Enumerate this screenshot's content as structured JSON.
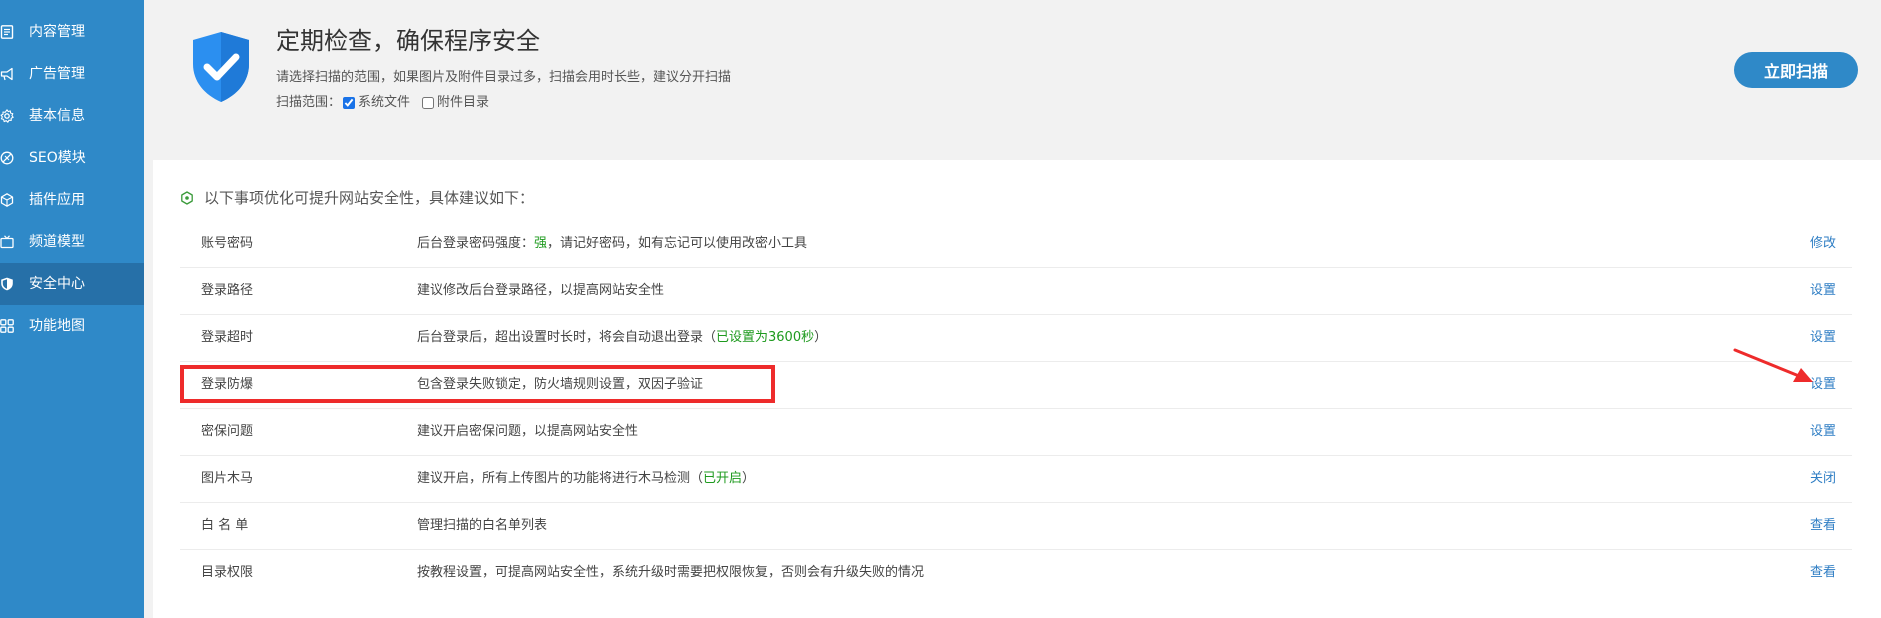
{
  "sidebar": {
    "items": [
      {
        "label": "内容管理",
        "icon": "document-icon",
        "active": false
      },
      {
        "label": "广告管理",
        "icon": "megaphone-icon",
        "active": false
      },
      {
        "label": "基本信息",
        "icon": "gear-icon",
        "active": false
      },
      {
        "label": "SEO模块",
        "icon": "tag-icon",
        "active": false
      },
      {
        "label": "插件应用",
        "icon": "hexagon-icon",
        "active": false
      },
      {
        "label": "频道模型",
        "icon": "tv-icon",
        "active": false
      },
      {
        "label": "安全中心",
        "icon": "shield-icon",
        "active": true
      },
      {
        "label": "功能地图",
        "icon": "grid-icon",
        "active": false
      }
    ]
  },
  "header": {
    "title": "定期检查，确保程序安全",
    "description": "请选择扫描的范围，如果图片及附件目录过多，扫描会用时长些，建议分开扫描",
    "scope_label": "扫描范围：",
    "scope_options": [
      {
        "label": "系统文件",
        "checked": true
      },
      {
        "label": "附件目录",
        "checked": false
      }
    ],
    "scan_button": "立即扫描"
  },
  "main": {
    "intro": "以下事项优化可提升网站安全性，具体建议如下：",
    "rows": [
      {
        "name": "账号密码",
        "desc_before": "后台登录密码强度：",
        "desc_highlight": "强",
        "desc_after": "，请记好密码，如有忘记可以使用改密小工具",
        "action": "修改"
      },
      {
        "name": "登录路径",
        "desc_before": "建议修改后台登录路径，以提高网站安全性",
        "desc_highlight": "",
        "desc_after": "",
        "action": "设置"
      },
      {
        "name": "登录超时",
        "desc_before": "后台登录后，超出设置时长时，将会自动退出登录（",
        "desc_highlight": "已设置为3600秒",
        "desc_after": "）",
        "action": "设置"
      },
      {
        "name": "登录防爆",
        "desc_before": "包含登录失败锁定，防火墙规则设置，双因子验证",
        "desc_highlight": "",
        "desc_after": "",
        "action": "设置"
      },
      {
        "name": "密保问题",
        "desc_before": "建议开启密保问题，以提高网站安全性",
        "desc_highlight": "",
        "desc_after": "",
        "action": "设置"
      },
      {
        "name": "图片木马",
        "desc_before": "建议开启，所有上传图片的功能将进行木马检测（",
        "desc_highlight": "已开启",
        "desc_after": "）",
        "action": "关闭"
      },
      {
        "name": "白 名 单",
        "desc_before": "管理扫描的白名单列表",
        "desc_highlight": "",
        "desc_after": "",
        "action": "查看"
      },
      {
        "name": "目录权限",
        "desc_before": "按教程设置，可提高网站安全性，系统升级时需要把权限恢复，否则会有升级失败的情况",
        "desc_highlight": "",
        "desc_after": "",
        "action": "查看"
      }
    ]
  },
  "colors": {
    "sidebar": "#2f89c8",
    "sidebar_active": "#2670a8",
    "accent": "#2f89c8",
    "link": "#2f7ec4",
    "ok_green": "#1e9a1e",
    "annotation_red": "#ee2b2b"
  }
}
